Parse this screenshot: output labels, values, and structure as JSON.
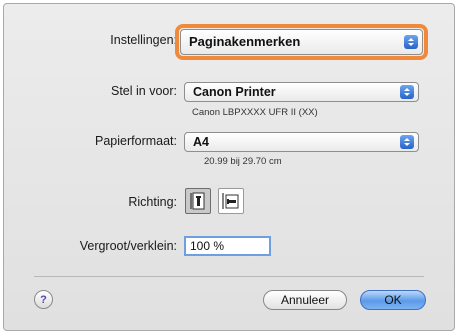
{
  "settings": {
    "label": "Instellingen:",
    "value": "Paginakenmerken"
  },
  "format_for": {
    "label": "Stel in voor:",
    "value": "Canon Printer",
    "description": "Canon LBPXXXX UFR II (XX)"
  },
  "paper_size": {
    "label": "Papierformaat:",
    "value": "A4",
    "dimensions": "20.99 bij 29.70 cm"
  },
  "orientation": {
    "label": "Richting:",
    "options": [
      "portrait",
      "landscape"
    ],
    "selected": "portrait"
  },
  "scale": {
    "label": "Vergroot/verklein:",
    "value": "100 %"
  },
  "buttons": {
    "help": "?",
    "cancel": "Annuleer",
    "ok": "OK"
  },
  "colors": {
    "focus_ring": "#f08a3a",
    "accent_blue": "#2a63c7"
  }
}
